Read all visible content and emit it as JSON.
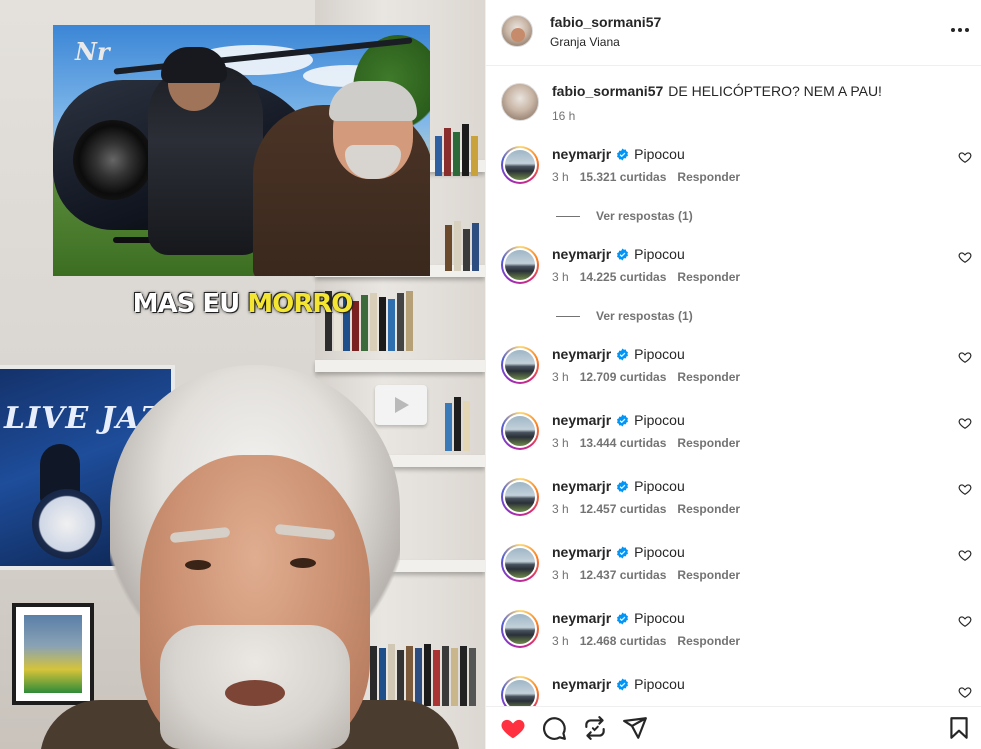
{
  "media": {
    "thumbnail_logo": "Nr",
    "caption_prefix": "MAS EU ",
    "caption_highlight": "MORRO",
    "poster_text": "LIVE JAZ"
  },
  "post": {
    "author": "fabio_sormani57",
    "location": "Granja Viana",
    "caption_author": "fabio_sormani57",
    "caption_text": "DE HELICÓPTERO? NEM A PAU!",
    "caption_time": "16 h"
  },
  "comments": [
    {
      "user": "neymarjr",
      "text": "Pipocou",
      "time": "3 h",
      "likes": "15.321 curtidas",
      "reply": "Responder",
      "replies": "Ver respostas (1)"
    },
    {
      "user": "neymarjr",
      "text": "Pipocou",
      "time": "3 h",
      "likes": "14.225 curtidas",
      "reply": "Responder",
      "replies": "Ver respostas (1)"
    },
    {
      "user": "neymarjr",
      "text": "Pipocou",
      "time": "3 h",
      "likes": "12.709 curtidas",
      "reply": "Responder"
    },
    {
      "user": "neymarjr",
      "text": "Pipocou",
      "time": "3 h",
      "likes": "13.444 curtidas",
      "reply": "Responder"
    },
    {
      "user": "neymarjr",
      "text": "Pipocou",
      "time": "3 h",
      "likes": "12.457 curtidas",
      "reply": "Responder"
    },
    {
      "user": "neymarjr",
      "text": "Pipocou",
      "time": "3 h",
      "likes": "12.437 curtidas",
      "reply": "Responder"
    },
    {
      "user": "neymarjr",
      "text": "Pipocou",
      "time": "3 h",
      "likes": "12.468 curtidas",
      "reply": "Responder"
    },
    {
      "user": "neymarjr",
      "text": "Pipocou"
    }
  ],
  "icons": {
    "more": "more-options-icon",
    "verified": "verified-badge-icon",
    "comment_like": "heart-outline-icon",
    "like": "heart-filled-icon",
    "comment": "comment-icon",
    "share": "repost-icon",
    "send": "send-icon",
    "save": "bookmark-icon"
  },
  "colors": {
    "like_red": "#ff3040",
    "verified_blue": "#0095f6",
    "caption_highlight": "#f3e532"
  }
}
